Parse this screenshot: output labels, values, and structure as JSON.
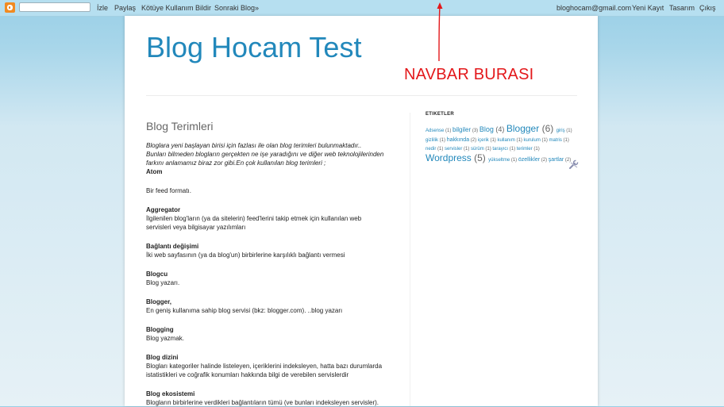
{
  "navbar": {
    "links": [
      "İzle",
      "Paylaş",
      "Kötüye Kullanım Bildir",
      "Sonraki Blog»"
    ],
    "user_links": [
      "bloghocam@gmail.com",
      "Yeni Kayıt",
      "Tasarım",
      "Çıkış"
    ],
    "search_value": "",
    "icons": [
      "blogger-logo-icon",
      "search-icon"
    ]
  },
  "annotation": {
    "label": "NAVBAR BURASI",
    "color": "#e3181b"
  },
  "blog": {
    "title": "Blog Hocam Test",
    "title_color": "#2288bb"
  },
  "post": {
    "title": "Blog Terimleri",
    "intro": [
      "Bloglara yeni başlayan birisi için fazlası ile olan blog terimleri bulunmaktadır..",
      "Bunları bilmeden blogların gerçekten ne işe yaradığını ve diğer web teknolojilerinden",
      "farkını anlamamız biraz zor gibi.En çok kullanılan blog terimleri ;"
    ],
    "terms": [
      {
        "term": "Atom",
        "definition": [
          "Bir feed formatı."
        ]
      },
      {
        "term": "Aggregator",
        "definition": [
          "İlgilenilen blog'ların (ya da sitelerin) feed'lerini takip etmek için kullanılan web",
          "servisleri veya bilgisayar yazılımları"
        ]
      },
      {
        "term": "Bağlantı değişimi",
        "definition": [
          "İki web sayfasının (ya da blog'un) birbirlerine karşılıklı bağlantı vermesi"
        ]
      },
      {
        "term": "Blogcu",
        "definition": [
          "Blog yazarı."
        ]
      },
      {
        "term": "Blogger,",
        "definition": [
          "En geniş kullanıma sahip blog servisi (bkz: blogger.com). ..blog yazarı"
        ]
      },
      {
        "term": "Blogging",
        "definition": [
          "Blog yazmak."
        ]
      },
      {
        "term": "Blog dizini",
        "definition": [
          "Blogları kategoriler halinde listeleyen, içeriklerini indeksleyen, hatta bazı durumlarda",
          "istatistikleri ve coğrafik konumları hakkında bilgi de verebilen servislerdir"
        ]
      },
      {
        "term": "Blog ekosistemi",
        "definition": [
          "Blogların birbirlerine verdikleri bağlantıların tümü (ve bunları indeksleyen servisler)."
        ]
      }
    ]
  },
  "sidebar": {
    "title": "ETIKETLER",
    "labels": [
      {
        "name": "Adsense",
        "count": "(1)",
        "size": 6
      },
      {
        "name": "bilgiler",
        "count": "(3)",
        "size": 8
      },
      {
        "name": "Blog",
        "count": "(4)",
        "size": 9
      },
      {
        "name": "Blogger",
        "count": "(6)",
        "size": 12
      },
      {
        "name": "giriş",
        "count": "(1)",
        "size": 6
      },
      {
        "name": "gizlilik",
        "count": "(1)",
        "size": 6
      },
      {
        "name": "hakkında",
        "count": "(2)",
        "size": 7
      },
      {
        "name": "içerik",
        "count": "(1)",
        "size": 6
      },
      {
        "name": "kullanım",
        "count": "(1)",
        "size": 6
      },
      {
        "name": "kurulum",
        "count": "(1)",
        "size": 6
      },
      {
        "name": "matris",
        "count": "(1)",
        "size": 6
      },
      {
        "name": "nedir",
        "count": "(1)",
        "size": 6
      },
      {
        "name": "servisler",
        "count": "(1)",
        "size": 6
      },
      {
        "name": "sürüm",
        "count": "(1)",
        "size": 6
      },
      {
        "name": "tarayıcı",
        "count": "(1)",
        "size": 6
      },
      {
        "name": "terimler",
        "count": "(1)",
        "size": 6
      },
      {
        "name": "Wordpress",
        "count": "(5)",
        "size": 12
      },
      {
        "name": "yükseltme",
        "count": "(1)",
        "size": 6
      },
      {
        "name": "özellikler",
        "count": "(2)",
        "size": 7
      },
      {
        "name": "şartlar",
        "count": "(2)",
        "size": 7
      }
    ],
    "edit_icon": "wrench-icon"
  }
}
